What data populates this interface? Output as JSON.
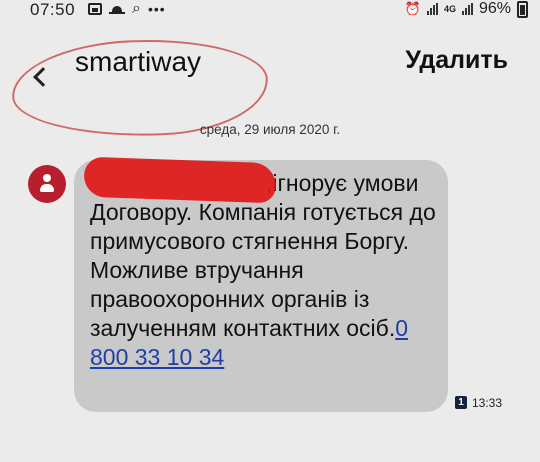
{
  "status_bar": {
    "time": "07:50",
    "icons_left": [
      "gallery-icon",
      "weather-icon",
      "search-icon",
      "more-icon"
    ],
    "network_label": "4G",
    "battery_percent": "96%"
  },
  "header": {
    "back_icon": "chevron-left-icon",
    "title": "smartiway",
    "delete_label": "Удалить"
  },
  "conversation": {
    "date": "среда, 29 июля 2020 г.",
    "message": {
      "text_visible": ",ігнорує умови Договору. Компанія готується до примусового стягнення Боргу. Можливе втручання правоохоронних органів із залученням контактних осіб.",
      "phone": "0 800 33 10 34",
      "sim_badge": "1",
      "time": "13:33"
    }
  },
  "colors": {
    "background": "#ebebeb",
    "bubble": "#c9c9c9",
    "avatar": "#b81e2c",
    "link": "#1f3fa8",
    "redaction": "#e01818",
    "annotation": "#d06a6a"
  }
}
